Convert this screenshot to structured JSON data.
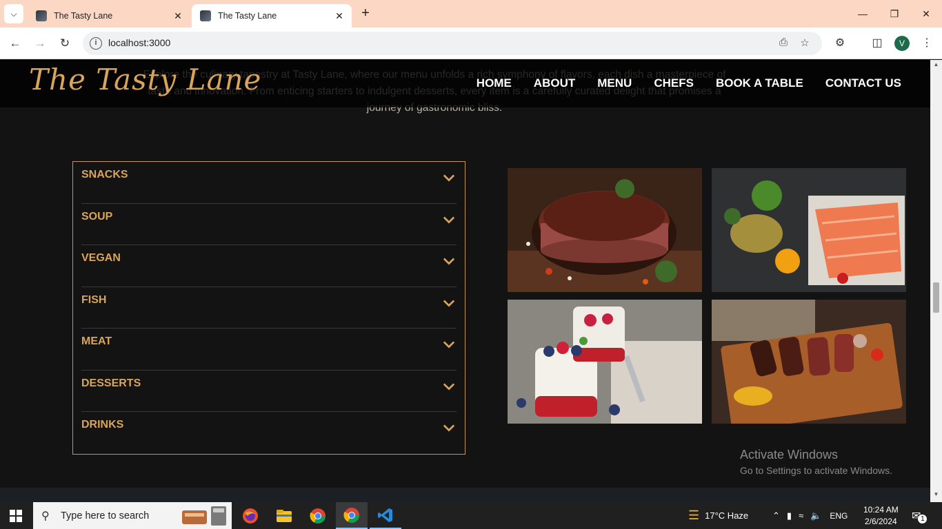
{
  "browser": {
    "tabs": [
      {
        "title": "The Tasty Lane",
        "active": false
      },
      {
        "title": "The Tasty Lane",
        "active": true
      }
    ],
    "url": "localhost:3000",
    "profile_initial": "V"
  },
  "site": {
    "logo": "The Tasty Lane",
    "nav": [
      "HOME",
      "ABOUT",
      "MENU",
      "CHEFS",
      "BOOK A TABLE",
      "CONTACT US"
    ],
    "intro": "Explore the culinary tapestry at Tasty Lane, where our menu unfolds a rich symphony of flavors, each dish a masterpiece of taste and innovation. From enticing starters to indulgent desserts, every item is a carefully curated delight that promises a journey of gastronomic bliss."
  },
  "menu": {
    "categories": [
      "SNACKS",
      "SOUP",
      "VEGAN",
      "FISH",
      "MEAT",
      "DESSERTS",
      "DRINKS"
    ]
  },
  "gallery": [
    "grilled-steak",
    "salmon-fillet",
    "berry-dessert",
    "sliced-steak-board"
  ],
  "watermark": {
    "line1": "Activate Windows",
    "line2": "Go to Settings to activate Windows."
  },
  "taskbar": {
    "search_placeholder": "Type here to search",
    "weather": "17°C  Haze",
    "language": "ENG",
    "time": "10:24 AM",
    "date": "2/6/2024",
    "notifications": "1"
  },
  "colors": {
    "accent": "#d9a55a",
    "page_bg": "#131313",
    "tabbar_bg": "#fcd8c4"
  }
}
